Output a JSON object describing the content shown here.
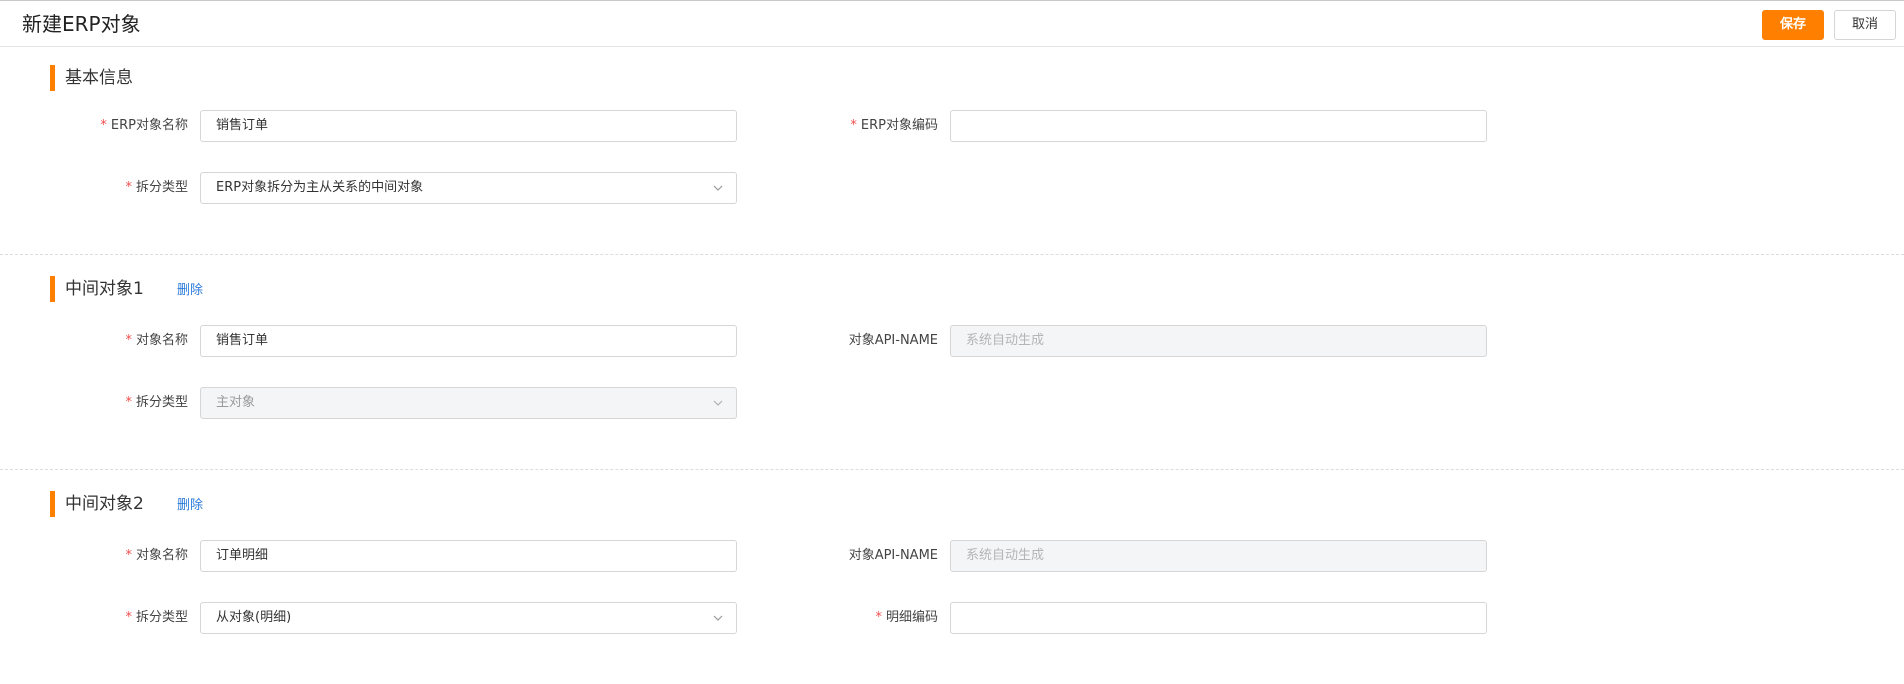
{
  "header": {
    "title": "新建ERP对象",
    "save_label": "保存",
    "cancel_label": "取消"
  },
  "basic": {
    "title": "基本信息",
    "name_label": "ERP对象名称",
    "name_value": "销售订单",
    "code_label": "ERP对象编码",
    "code_value": "",
    "split_label": "拆分类型",
    "split_value": "ERP对象拆分为主从关系的中间对象"
  },
  "mid1": {
    "title": "中间对象1",
    "delete_label": "删除",
    "name_label": "对象名称",
    "name_value": "销售订单",
    "api_label": "对象API-NAME",
    "api_placeholder": "系统自动生成",
    "split_label": "拆分类型",
    "split_value": "主对象"
  },
  "mid2": {
    "title": "中间对象2",
    "delete_label": "删除",
    "name_label": "对象名称",
    "name_value": "订单明细",
    "api_label": "对象API-NAME",
    "api_placeholder": "系统自动生成",
    "split_label": "拆分类型",
    "split_value": "从对象(明细)",
    "detail_code_label": "明细编码",
    "detail_code_value": ""
  },
  "icons": {
    "select_arrow": "chevron-down-icon"
  },
  "colors": {
    "accent": "#ff8000",
    "link": "#2b7ad9",
    "required": "#f04b4b",
    "disabled_bg": "#f4f5f7"
  }
}
